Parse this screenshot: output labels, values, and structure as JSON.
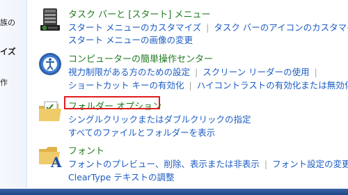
{
  "left_pane": {
    "items": [
      "族の",
      "イズ",
      "作"
    ]
  },
  "sections": [
    {
      "icon": "taskbar-start-menu-icon",
      "title": "タスク バーと [スタート] メニュー",
      "lines": [
        [
          "スタート メニューのカスタマイズ",
          "タスク バーのアイコンのカスタマイズ"
        ],
        [
          "スタート メニューの画像の変更"
        ]
      ]
    },
    {
      "icon": "ease-of-access-icon",
      "title": "コンピューターの簡単操作センター",
      "lines": [
        [
          "視力制限がある方のための設定",
          "スクリーン リーダーの使用",
          ""
        ],
        [
          "ショートカット キーの有効化",
          "ハイコントラストの有効化または無効化"
        ]
      ]
    },
    {
      "icon": "folder-options-icon",
      "title": "フォルダー オプション",
      "lines": [
        [
          "シングルクリックまたはダブルクリックの指定"
        ],
        [
          "すべてのファイルとフォルダーを表示"
        ]
      ]
    },
    {
      "icon": "fonts-folder-icon",
      "title": "フォント",
      "lines": [
        [
          "フォントのプレビュー、削除、表示または非表示",
          "フォント設定の変更"
        ],
        [
          "ClearType テキストの調整"
        ]
      ]
    }
  ],
  "highlight_color": "#e01c1c",
  "link_color": "#1c5cc4",
  "title_color": "#1f7a1f"
}
